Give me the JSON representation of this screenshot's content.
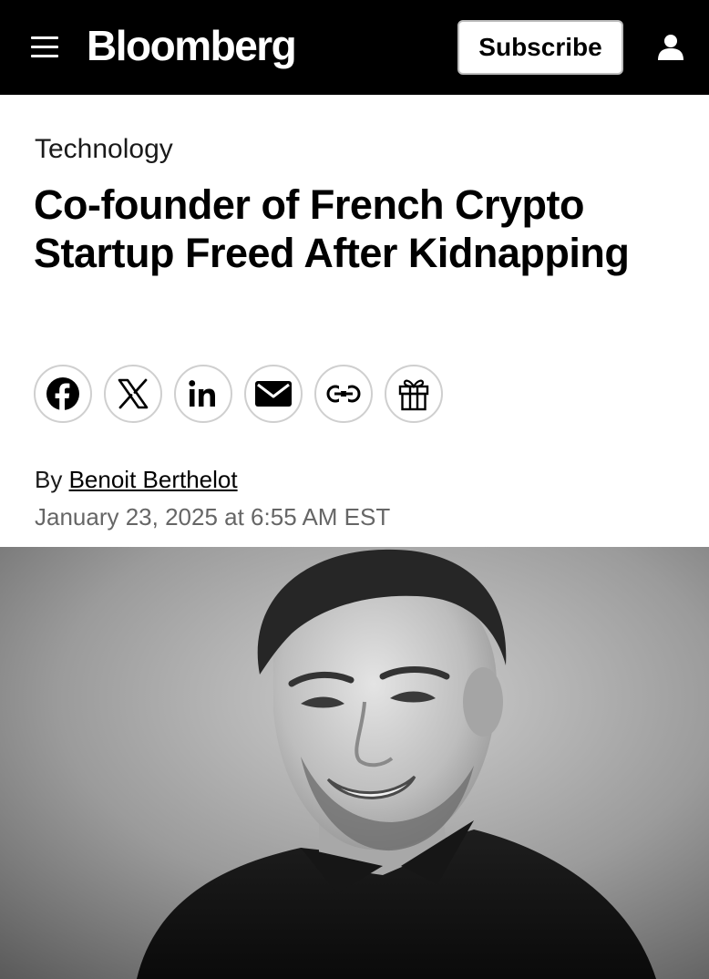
{
  "header": {
    "brand": "Bloomberg",
    "subscribe_label": "Subscribe",
    "menu_icon": "hamburger-menu-icon",
    "user_icon": "user-icon"
  },
  "article": {
    "category": "Technology",
    "headline": "Co-founder of French Crypto Startup Freed After Kidnapping",
    "byline_prefix": "By",
    "author": "Benoit Berthelot",
    "timestamp": "January 23, 2025 at 6:55 AM EST"
  },
  "share_buttons": [
    {
      "icon": "facebook-icon"
    },
    {
      "icon": "x-icon"
    },
    {
      "icon": "linkedin-icon"
    },
    {
      "icon": "email-icon"
    },
    {
      "icon": "link-icon"
    },
    {
      "icon": "gift-icon"
    }
  ],
  "colors": {
    "header_bg": "#000000",
    "text": "#000000",
    "muted": "#666666"
  }
}
